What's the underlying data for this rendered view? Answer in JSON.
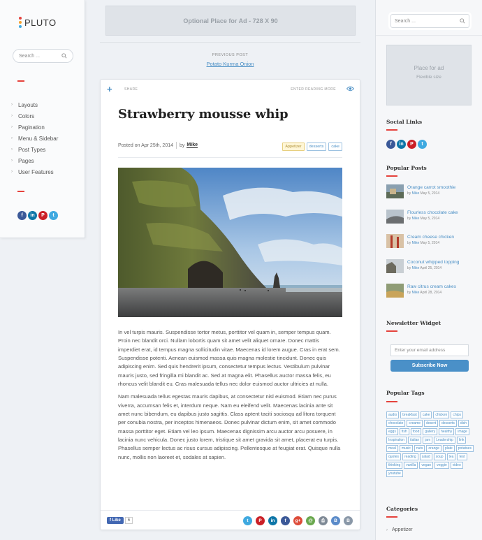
{
  "left_sidebar": {
    "logo_text": "PLUTO",
    "logo_dot_colors": [
      "#e5423c",
      "#f4a12d",
      "#3fa9e0"
    ],
    "search_placeholder": "Search ...",
    "menu": [
      {
        "label": "Layouts"
      },
      {
        "label": "Colors"
      },
      {
        "label": "Pagination"
      },
      {
        "label": "Menu & Sidebar"
      },
      {
        "label": "Post Types"
      },
      {
        "label": "Pages"
      },
      {
        "label": "User Features"
      }
    ],
    "social_icons": [
      "facebook-icon",
      "linkedin-icon",
      "pinterest-icon",
      "twitter-icon"
    ]
  },
  "top_ad": {
    "text": "Optional Place for Ad - 728 X 90"
  },
  "prev_post": {
    "label": "PREVIOUS POST",
    "link": "Potato Kurma Onion"
  },
  "post": {
    "toolbar": {
      "share_label": "SHARE",
      "reading_mode_label": "ENTER READING MODE"
    },
    "title": "Strawberry mousse whip",
    "posted_on": "Posted on Apr 25th, 2014",
    "by_label": "by",
    "author": "Mike",
    "tags": [
      "Appetizer",
      "desserts",
      "cake"
    ],
    "paragraphs": [
      "In vel turpis mauris. Suspendisse tortor metus, porttitor vel quam in, semper tempus quam. Proin nec blandit orci. Nullam lobortis quam sit amet velit aliquet ornare. Donec mattis imperdiet erat, id tempus magna sollicitudin vitae. Maecenas id lorem augue. Cras in erat sem. Suspendisse potenti. Aenean euismod massa quis magna molestie tincidunt. Donec quis adipiscing enim. Sed quis hendrerit ipsum, consectetur tempus lectus. Vestibulum pulvinar mauris justo, sed fringilla mi blandit ac. Sed at magna elit. Phasellus auctor massa felis, eu rhoncus velit blandit eu. Cras malesuada tellus nec dolor euismod auctor ultricies at nulla.",
      "Nam malesuada tellus egestas mauris dapibus, at consectetur nisl euismod. Etiam nec purus viverra, accumsan felis et, interdum neque. Nam eu eleifend velit. Maecenas lacinia ante sit amet nunc bibendum, eu dapibus justo sagittis. Class aptent taciti sociosqu ad litora torquent per conubia nostra, per inceptos himenaeos. Donec pulvinar dictum enim, sit amet commodo massa porttitor eget. Etiam vel leo ipsum. Maecenas dignissim arcu auctor arcu posuere, in lacinia nunc vehicula. Donec justo lorem, tristique sit amet gravida sit amet, placerat eu turpis. Phasellus semper lectus ac risus cursus adipiscing. Pellentesque at feugiat erat. Quisque nulla nunc, mollis non laoreet et, sodales at sapien."
    ],
    "footer": {
      "like_label": "Like",
      "like_count": "6",
      "share_icons": [
        {
          "name": "twitter-icon",
          "color": "#3fa9e0",
          "glyph": "t"
        },
        {
          "name": "pinterest-icon",
          "color": "#cb2027",
          "glyph": "P"
        },
        {
          "name": "linkedin-icon",
          "color": "#0e76a8",
          "glyph": "in"
        },
        {
          "name": "facebook-icon",
          "color": "#3b5998",
          "glyph": "f"
        },
        {
          "name": "googleplus-icon",
          "color": "#dd4b39",
          "glyph": "g+"
        },
        {
          "name": "email-icon",
          "color": "#6aa84f",
          "glyph": "@"
        },
        {
          "name": "print-icon",
          "color": "#7f8a96",
          "glyph": "⎙"
        },
        {
          "name": "bookmark-icon",
          "color": "#5b8bc9",
          "glyph": "B"
        },
        {
          "name": "blogger-icon",
          "color": "#8a98a8",
          "glyph": "B"
        }
      ]
    }
  },
  "right_sidebar": {
    "search_placeholder": "Search ...",
    "ad": {
      "title": "Place for ad",
      "subtitle": "Flexible size"
    },
    "social_links_heading": "Social Links",
    "popular_posts_heading": "Popular Posts",
    "popular_posts": [
      {
        "title": "Orange carrot smoothie",
        "by": "by",
        "author": "Mike",
        "date": "May 5, 2014"
      },
      {
        "title": "Flourless chocolate cake",
        "by": "by",
        "author": "Mike",
        "date": "May 5, 2014"
      },
      {
        "title": "Cream cheese chicken",
        "by": "by",
        "author": "Mike",
        "date": "May 5, 2014"
      },
      {
        "title": "Coconut whipped topping",
        "by": "by",
        "author": "Mike",
        "date": "April 25, 2014"
      },
      {
        "title": "Raw citrus cream cakes",
        "by": "by",
        "author": "Mike",
        "date": "April 28, 2014"
      }
    ],
    "newsletter_heading": "Newsletter Widget",
    "newsletter_placeholder": "Enter your email address",
    "newsletter_button": "Subscribe Now",
    "tags_heading": "Popular Tags",
    "tags": [
      "audio",
      "breakfast",
      "cake",
      "chicken",
      "chips",
      "chocolate",
      "creame",
      "desert",
      "desserts",
      "dish",
      "eggs",
      "fish",
      "food",
      "gallery",
      "healthy",
      "image",
      "Inspiration",
      "italian",
      "jam",
      "Leadership",
      "link",
      "meal",
      "music",
      "nuts",
      "orange",
      "plate",
      "potatoes",
      "quotes",
      "reading",
      "salad",
      "soup",
      "tea",
      "test",
      "thinking",
      "vanilla",
      "vegan",
      "veggie",
      "video",
      "youtube"
    ],
    "categories_heading": "Categories",
    "categories": [
      "Appetizer"
    ]
  }
}
